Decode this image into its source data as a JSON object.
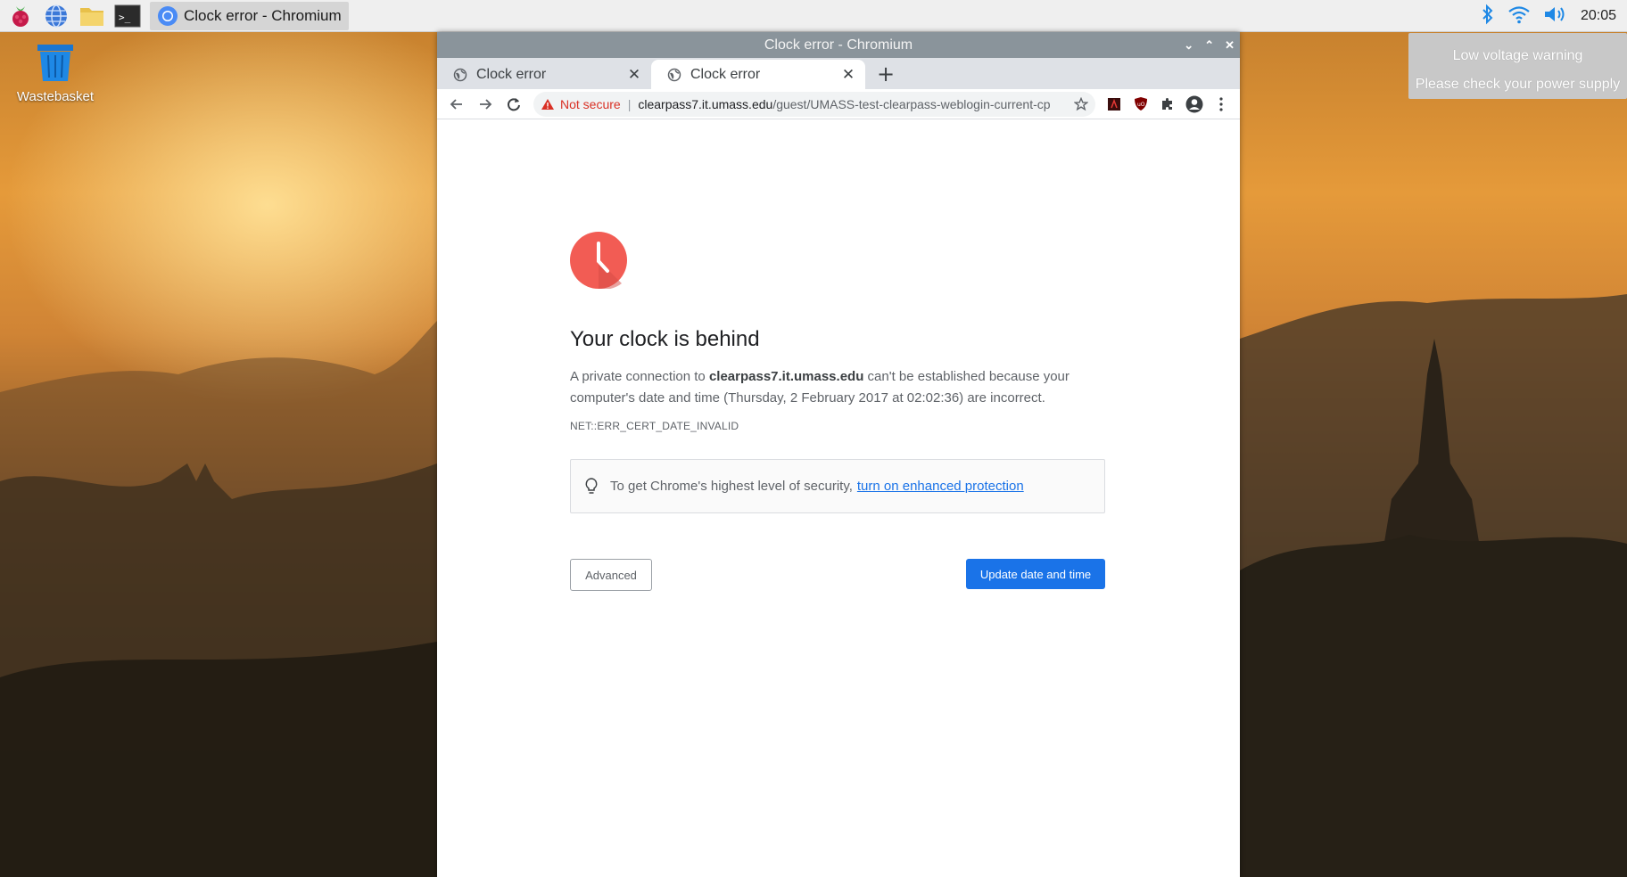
{
  "taskbar": {
    "task_label": "Clock error - Chromium",
    "clock": "20:05"
  },
  "desktop": {
    "wastebasket_label": "Wastebasket"
  },
  "notification": {
    "line1": "Low voltage warning",
    "line2": "Please check your power supply"
  },
  "window": {
    "title": "Clock error - Chromium"
  },
  "tabs": [
    {
      "title": "Clock error"
    },
    {
      "title": "Clock error"
    }
  ],
  "omnibox": {
    "security_label": "Not secure",
    "host": "clearpass7.it.umass.edu",
    "path": "/guest/UMASS-test-clearpass-weblogin-current-cp"
  },
  "page": {
    "title": "Your clock is behind",
    "body_prefix": "A private connection to ",
    "body_host": "clearpass7.it.umass.edu",
    "body_suffix": " can't be established because your computer's date and time (Thursday, 2 February 2017 at 02:02:36) are incorrect.",
    "error_code": "NET::ERR_CERT_DATE_INVALID",
    "tip_text": "To get Chrome's highest level of security,",
    "tip_link": "turn on enhanced protection",
    "advanced_label": "Advanced",
    "update_label": "Update date and time"
  },
  "colors": {
    "accent_blue": "#1a73e8",
    "error_red": "#f25c54",
    "not_secure_red": "#d93025"
  },
  "icons": [
    "raspberry-menu-icon",
    "web-browser-icon",
    "file-manager-icon",
    "terminal-icon",
    "chromium-icon",
    "bluetooth-icon",
    "wifi-icon",
    "volume-icon",
    "wastebasket-icon",
    "clock-error-icon",
    "lightbulb-icon"
  ]
}
